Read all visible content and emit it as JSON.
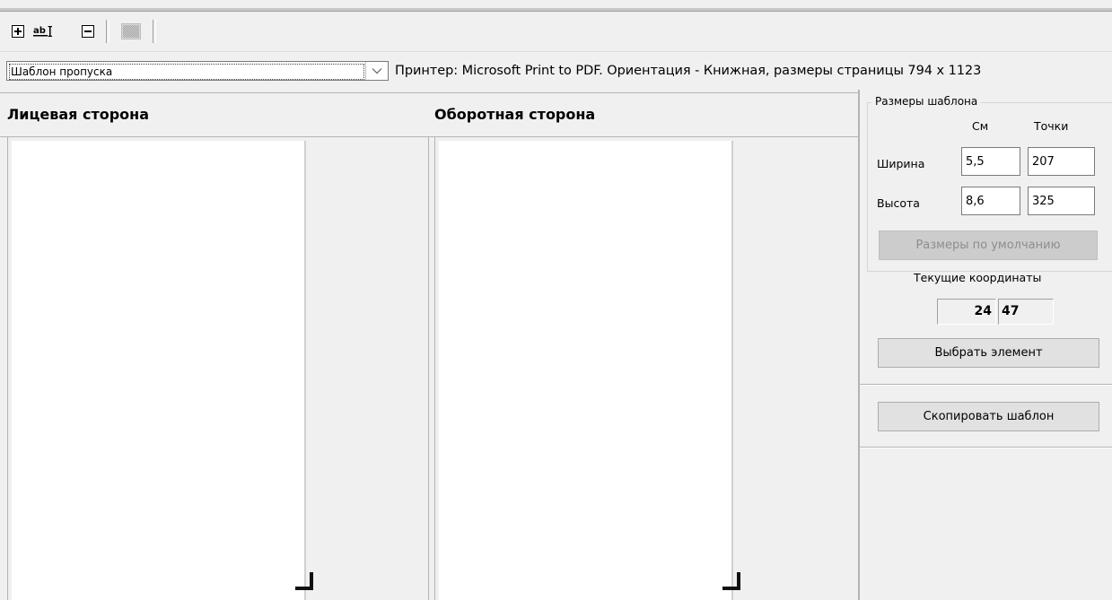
{
  "toolbar": {
    "buttons": [
      {
        "icon": "add-icon"
      },
      {
        "icon": "text-field-icon",
        "label": "ab"
      },
      {
        "icon": "remove-icon"
      },
      {
        "icon": "background-pattern-icon"
      }
    ]
  },
  "template_select": {
    "value": "Шаблон пропуска"
  },
  "printer_info": "Принтер: Microsoft Print to PDF. Ориентация - Книжная, размеры страницы 794 x 1123",
  "sides": {
    "front_title": "Лицевая сторона",
    "back_title": "Оборотная сторона"
  },
  "template_sizes": {
    "legend": "Размеры шаблона",
    "col_cm": "См",
    "col_points": "Точки",
    "width_label": "Ширина",
    "height_label": "Высота",
    "width_cm": "5,5",
    "width_points": "207",
    "height_cm": "8,6",
    "height_points": "325",
    "default_button": "Размеры по умолчанию"
  },
  "coordinates": {
    "label": "Текущие координаты",
    "x": "24",
    "y": "47"
  },
  "select_element_button": "Выбрать элемент",
  "copy_template_button": "Скопировать шаблон"
}
